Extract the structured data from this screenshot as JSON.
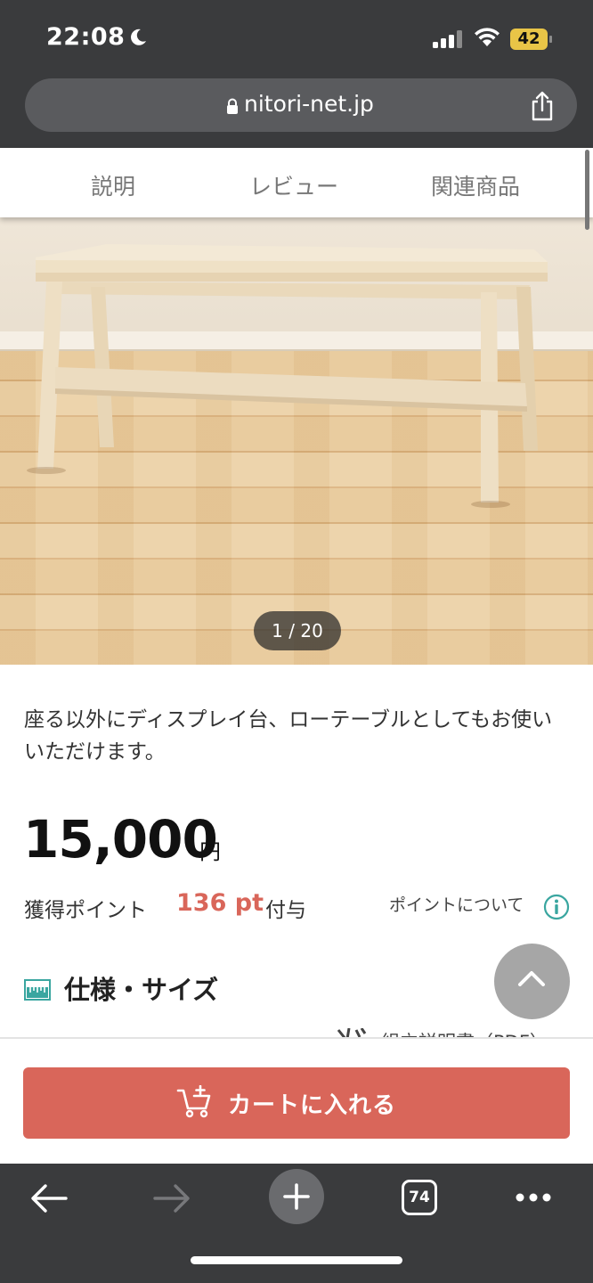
{
  "status_bar": {
    "time": "22:08",
    "battery": "42"
  },
  "browser": {
    "url": "nitori-net.jp",
    "tabs_count": "74"
  },
  "tabs": [
    {
      "label": "説明"
    },
    {
      "label": "レビュー"
    },
    {
      "label": "関連商品"
    }
  ],
  "product": {
    "image_counter": "1 / 20",
    "description": "座る以外にディスプレイ台、ローテーブルとしてもお使いいただけます。",
    "price": "15,000",
    "currency": "円",
    "points_label": "獲得ポイント",
    "points_value": "136 pt",
    "points_suffix": "付与",
    "points_about": "ポイントについて"
  },
  "specs": {
    "heading": "仕様・サイズ",
    "manual_link": "組立説明書（PDF）"
  },
  "cart": {
    "label": "カートに入れる"
  },
  "colors": {
    "accent": "#d9665a",
    "chrome": "#3a3b3d",
    "info": "#3aa6a0"
  }
}
